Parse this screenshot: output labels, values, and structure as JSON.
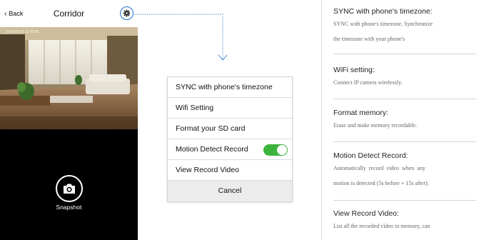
{
  "phone": {
    "back_label": "Back",
    "title": "Corridor",
    "camera_timestamp": "2014-06-07  11:43:58",
    "snapshot_label": "Snapshot"
  },
  "menu": {
    "items": [
      {
        "label": "SYNC with phone's timezone"
      },
      {
        "label": "Wifi Setting"
      },
      {
        "label": "Format your SD card"
      },
      {
        "label": "Motion Detect Record",
        "toggle_on": true
      },
      {
        "label": "View Record Video"
      }
    ],
    "cancel_label": "Cancel",
    "toggle_color": "#3cb33c"
  },
  "descriptions": [
    {
      "heading": "SYNC with phone's timezone:",
      "lines": [
        "SYNC with phone's timezone. Synchronize",
        "the timezone with your phone's"
      ]
    },
    {
      "heading": "WiFi setting:",
      "lines": [
        "Connect IP camera wirelessly."
      ]
    },
    {
      "heading": "Format memory:",
      "lines": [
        "Erase and make memory recordable."
      ]
    },
    {
      "heading": "Motion Detect Record:",
      "lines": [
        "Automatically  record  video  when  any",
        "motion is detected (5s before + 15s after)."
      ]
    },
    {
      "heading": "View Record Video:",
      "lines": [
        "List all the recorded video in memory, can"
      ]
    }
  ],
  "colors": {
    "accent": "#1b6fd1",
    "phone_bg": "#000000"
  }
}
